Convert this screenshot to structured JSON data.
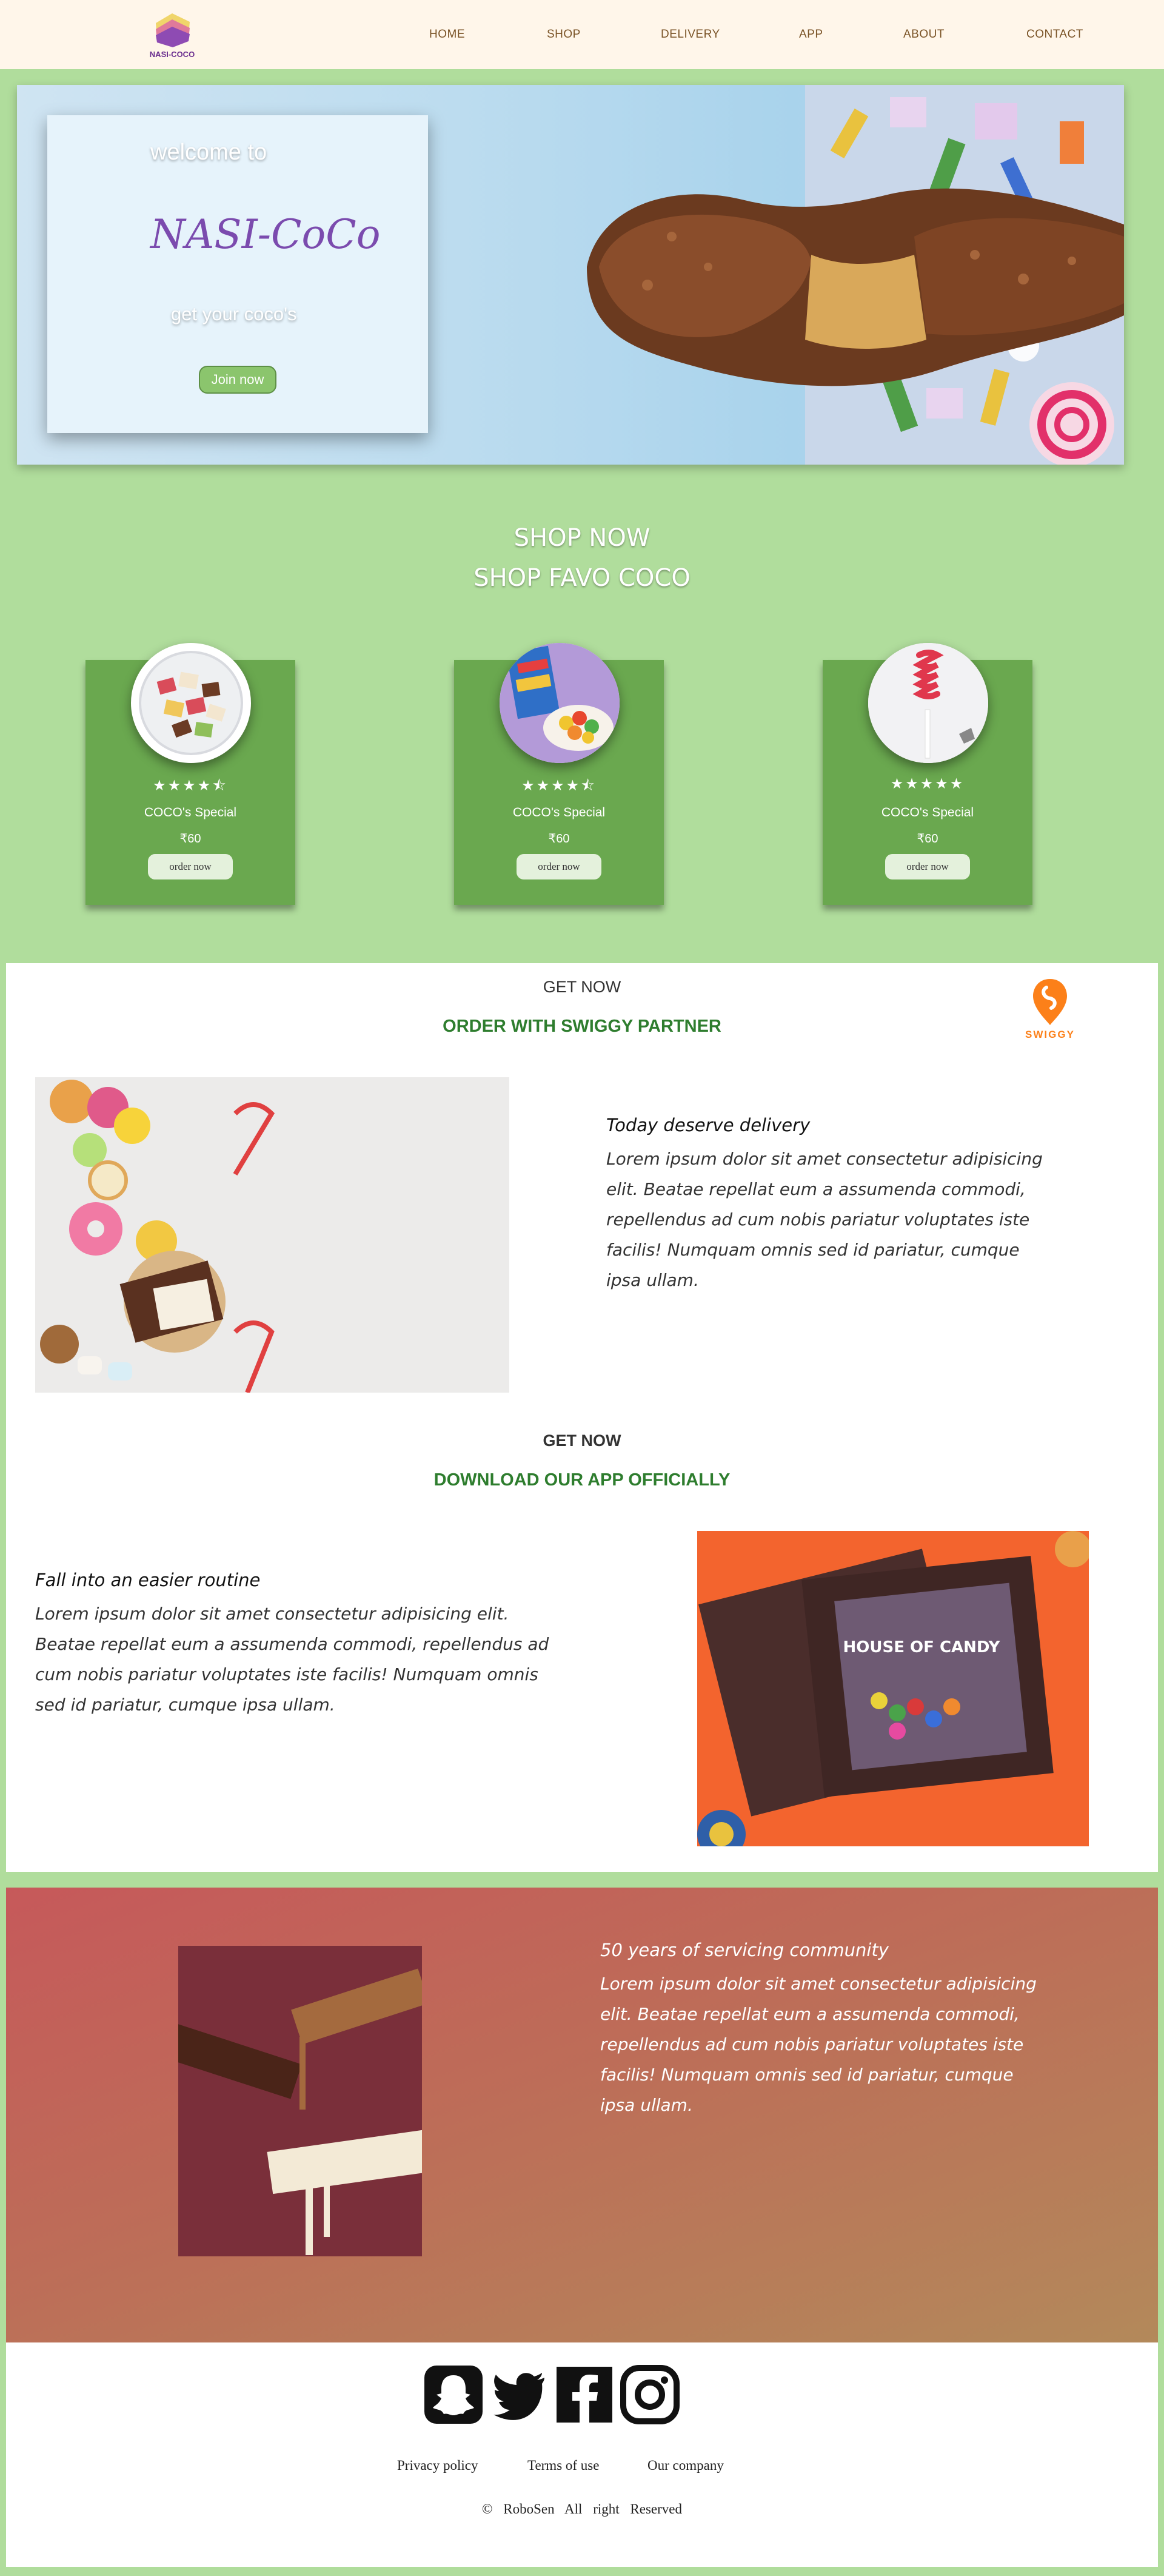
{
  "nav": {
    "logo_text": "NASI-COCO",
    "links": [
      "HOME",
      "SHOP",
      "DELIVERY",
      "APP",
      "ABOUT",
      "CONTACT"
    ]
  },
  "hero": {
    "welcome": "welcome to",
    "title": "NASI-CoCo",
    "tagline": "get your coco's",
    "button": "Join now"
  },
  "shop": {
    "title_line1": "SHOP NOW",
    "title_line2": "SHOP FAVO COCO",
    "products": [
      {
        "image": "assorted-candies-plate",
        "rating": 4.5,
        "stars": "★★★★⯪",
        "name": "COCO's Special",
        "price": "₹60",
        "button": "order now"
      },
      {
        "image": "gummy-bears-bowl",
        "rating": 4.5,
        "stars": "★★★★⯪",
        "name": "COCO's Special",
        "price": "₹60",
        "button": "order now"
      },
      {
        "image": "red-lollipop-candy",
        "rating": 5,
        "stars": "★★★★★",
        "name": "COCO's Special",
        "price": "₹60",
        "button": "order now"
      }
    ]
  },
  "delivery": {
    "label": "GET NOW",
    "heading": "ORDER WITH SWIGGY PARTNER",
    "partner_logo_text": "SWIGGY",
    "image": "sweets-macarons-donut-chocolate",
    "text_heading": "Today deserve delivery",
    "text_body": "Lorem ipsum dolor sit amet consectetur adipisicing elit. Beatae repellat eum a assumenda commodi, repellendus ad cum nobis pariatur voluptates iste facilis! Numquam omnis sed id pariatur, cumque ipsa ullam."
  },
  "app": {
    "label": "GET NOW",
    "heading": "DOWNLOAD OUR APP OFFICIALLY",
    "image": "house-of-candy-box",
    "box_text": "HOUSE OF CANDY",
    "text_heading": "Fall into an easier routine",
    "text_body": "Lorem ipsum dolor sit amet consectetur adipisicing elit. Beatae repellat eum a assumenda commodi, repellendus ad cum nobis pariatur voluptates iste facilis! Numquam omnis sed id pariatur, cumque ipsa ullam."
  },
  "community": {
    "image": "melting-chocolate-bars",
    "text_heading": "50 years of servicing community",
    "text_body": "Lorem ipsum dolor sit amet consectetur adipisicing elit. Beatae repellat eum a assumenda commodi, repellendus ad cum nobis pariatur voluptates iste facilis! Numquam omnis sed id pariatur, cumque ipsa ullam."
  },
  "footer": {
    "social_icons": [
      "snapchat-icon",
      "twitter-icon",
      "facebook-icon",
      "instagram-icon"
    ],
    "links": [
      "Privacy policy",
      "Terms of use",
      "Our company"
    ],
    "copyright": "© RoboSen All right Reserved"
  },
  "colors": {
    "page_bg": "#b0dd9c",
    "nav_bg": "#fff6ea",
    "nav_link": "#7a5326",
    "card_green": "#6aa84f",
    "heading_green": "#2e7d2e",
    "brand_purple": "#7b4bae",
    "swiggy_orange": "#fc8019"
  }
}
